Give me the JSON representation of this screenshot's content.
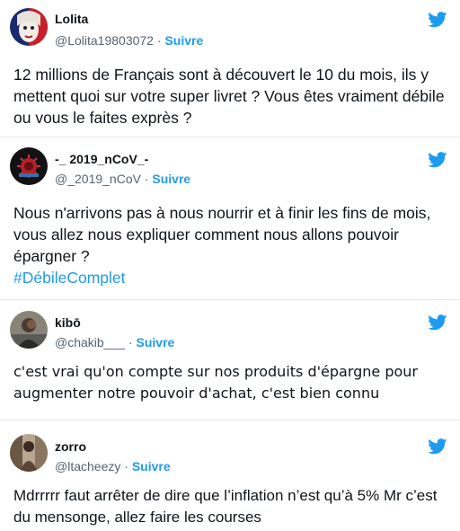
{
  "tweets": [
    {
      "name": "Lolita",
      "handle": "@Lolita19803072",
      "separator": "·",
      "follow": "Suivre",
      "text": "12 millions de Français sont à découvert le 10 du mois, ils y mettent quoi sur votre super livret ? Vous êtes vraiment débile ou vous le faites exprès ?",
      "hashtag": ""
    },
    {
      "name": "-_ 2019_nCoV_-",
      "handle": "@_2019_nCoV",
      "separator": "·",
      "follow": "Suivre",
      "text": "Nous n'arrivons pas à nous nourrir et à finir les fins de mois, vous allez nous expliquer comment nous allons pouvoir épargner ?",
      "hashtag": "#DébileComplet"
    },
    {
      "name": "kibō",
      "handle": "@chakib___",
      "separator": "·",
      "follow": "Suivre",
      "text": "c'est vrai qu'on compte sur nos produits d'épargne pour augmenter notre pouvoir d'achat, c'est bien connu",
      "hashtag": ""
    },
    {
      "name": "zorro",
      "handle": "@ltacheezy",
      "separator": "·",
      "follow": "Suivre",
      "text": "Mdrrrrr faut arrêter de dire que l’inflation n’est qu’à 5% Mr c’est du mensonge, allez faire les courses",
      "hashtag": ""
    }
  ],
  "icons": {
    "brand": "twitter-bird-icon",
    "brand_color": "#1d9bf0",
    "link_color": "#1d9bf0"
  }
}
